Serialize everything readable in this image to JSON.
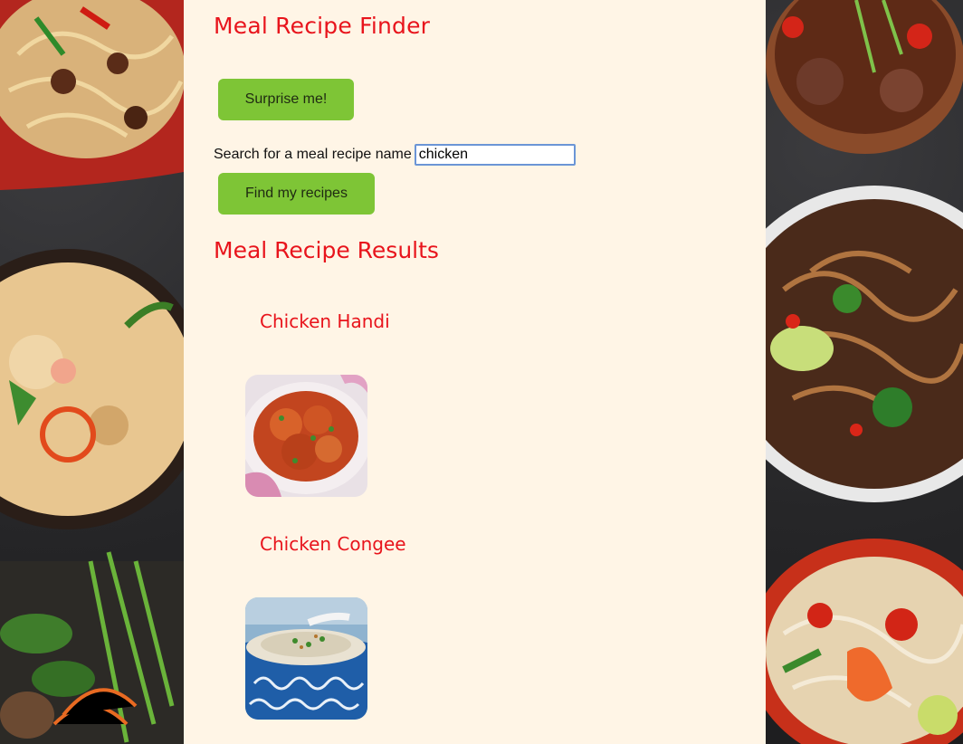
{
  "page": {
    "title": "Meal Recipe Finder"
  },
  "actions": {
    "surprise_label": "Surprise me!",
    "find_label": "Find my recipes"
  },
  "search": {
    "label": "Search for a meal recipe name",
    "value": "chicken"
  },
  "results": {
    "heading": "Meal Recipe Results",
    "items": [
      {
        "name": "Chicken Handi",
        "image_icon": "chicken-handi-photo"
      },
      {
        "name": "Chicken Congee",
        "image_icon": "chicken-congee-photo"
      }
    ]
  },
  "colors": {
    "heading": "#e8141c",
    "button": "#7ec536",
    "panel": "#fff5e6",
    "input_border": "#6b95d6"
  }
}
